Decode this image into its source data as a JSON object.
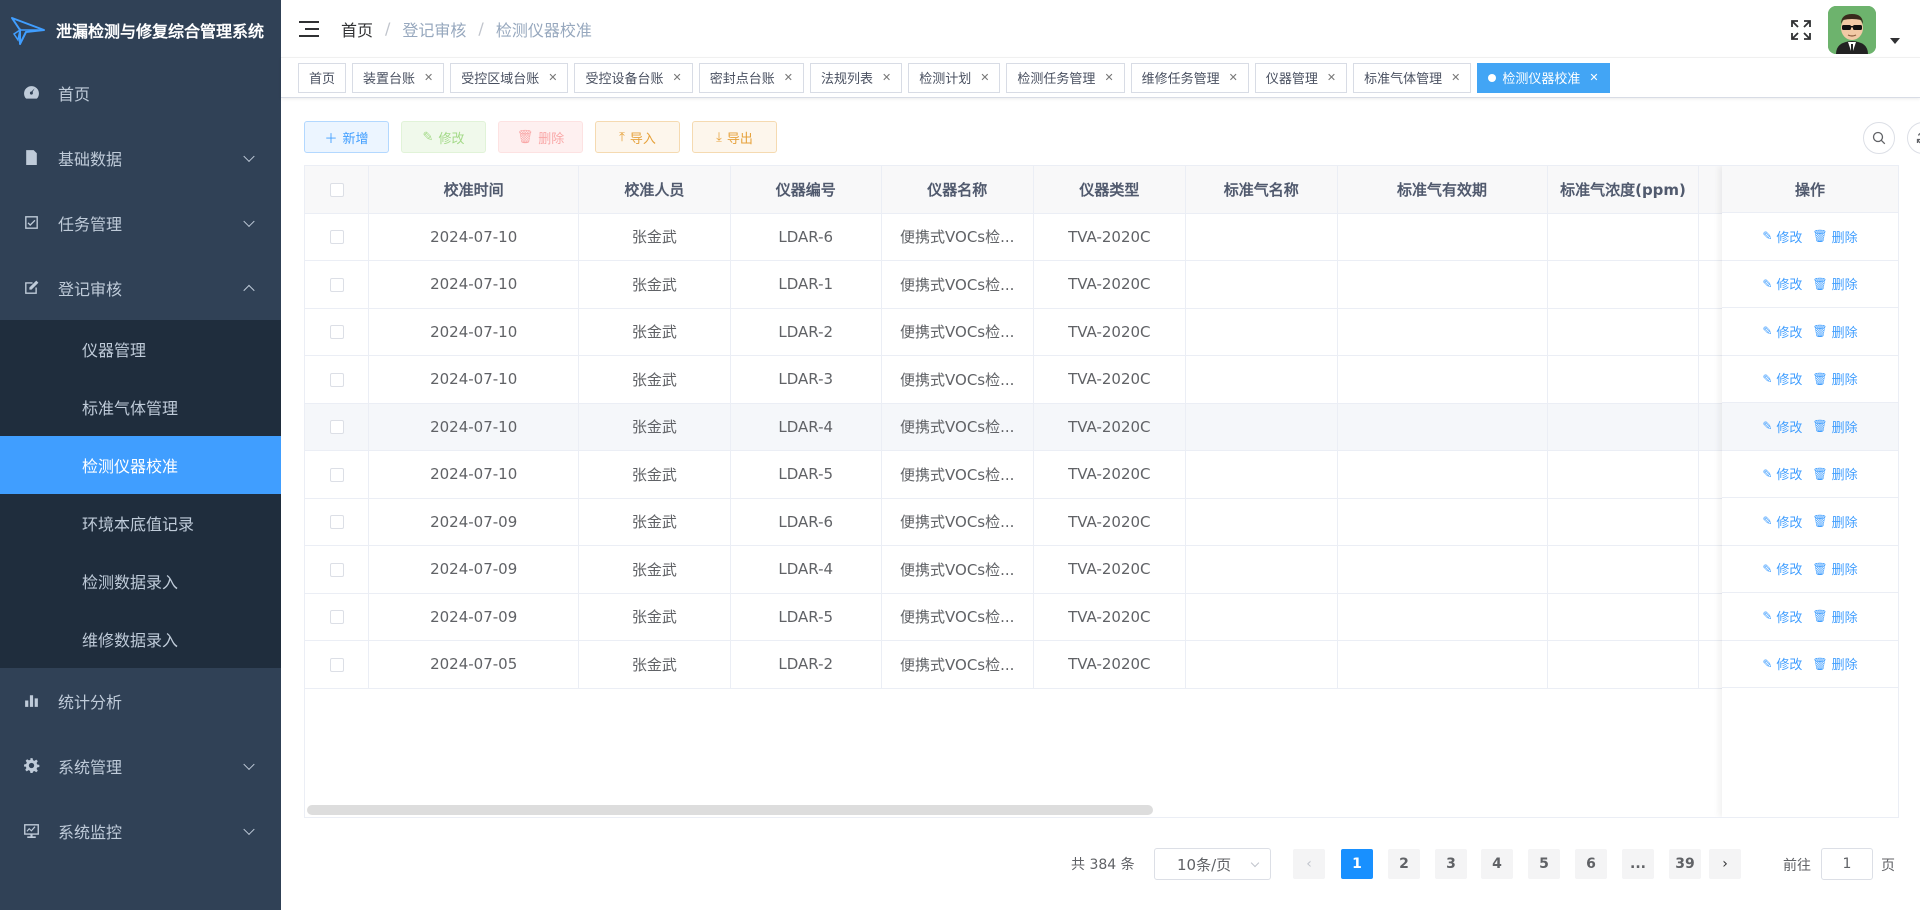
{
  "app": {
    "title": "泄漏检测与修复综合管理系统"
  },
  "sidebar": {
    "items": [
      {
        "label": "首页",
        "icon": "dashboard-icon"
      },
      {
        "label": "基础数据",
        "icon": "document-icon",
        "expandable": true
      },
      {
        "label": "任务管理",
        "icon": "checkbox-icon",
        "expandable": true
      },
      {
        "label": "登记审核",
        "icon": "edit-icon",
        "expandable": true,
        "expanded": true
      },
      {
        "label": "统计分析",
        "icon": "bar-chart-icon"
      },
      {
        "label": "系统管理",
        "icon": "gear-icon",
        "expandable": true
      },
      {
        "label": "系统监控",
        "icon": "monitor-icon",
        "expandable": true
      }
    ],
    "submenu": [
      "仪器管理",
      "标准气体管理",
      "检测仪器校准",
      "环境本底值记录",
      "检测数据录入",
      "维修数据录入"
    ],
    "active_sub": "检测仪器校准"
  },
  "breadcrumb": [
    "首页",
    "登记审核",
    "检测仪器校准"
  ],
  "tags": [
    {
      "label": "首页",
      "closable": false
    },
    {
      "label": "装置台账",
      "closable": true
    },
    {
      "label": "受控区域台账",
      "closable": true
    },
    {
      "label": "受控设备台账",
      "closable": true
    },
    {
      "label": "密封点台账",
      "closable": true
    },
    {
      "label": "法规列表",
      "closable": true
    },
    {
      "label": "检测计划",
      "closable": true
    },
    {
      "label": "检测任务管理",
      "closable": true
    },
    {
      "label": "维修任务管理",
      "closable": true
    },
    {
      "label": "仪器管理",
      "closable": true
    },
    {
      "label": "标准气体管理",
      "closable": true
    },
    {
      "label": "检测仪器校准",
      "closable": true,
      "active": true
    }
  ],
  "toolbar": {
    "add": "新增",
    "edit": "修改",
    "delete": "删除",
    "import": "导入",
    "export": "导出"
  },
  "table": {
    "columns": [
      "校准时间",
      "校准人员",
      "仪器编号",
      "仪器名称",
      "仪器类型",
      "标准气名称",
      "标准气有效期",
      "标准气浓度(ppm)",
      "操作"
    ],
    "rows": [
      {
        "time": "2024-07-10",
        "person": "张金武",
        "code": "LDAR-6",
        "name": "便携式VOCs检...",
        "type": "TVA-2020C"
      },
      {
        "time": "2024-07-10",
        "person": "张金武",
        "code": "LDAR-1",
        "name": "便携式VOCs检...",
        "type": "TVA-2020C"
      },
      {
        "time": "2024-07-10",
        "person": "张金武",
        "code": "LDAR-2",
        "name": "便携式VOCs检...",
        "type": "TVA-2020C"
      },
      {
        "time": "2024-07-10",
        "person": "张金武",
        "code": "LDAR-3",
        "name": "便携式VOCs检...",
        "type": "TVA-2020C"
      },
      {
        "time": "2024-07-10",
        "person": "张金武",
        "code": "LDAR-4",
        "name": "便携式VOCs检...",
        "type": "TVA-2020C"
      },
      {
        "time": "2024-07-10",
        "person": "张金武",
        "code": "LDAR-5",
        "name": "便携式VOCs检...",
        "type": "TVA-2020C"
      },
      {
        "time": "2024-07-09",
        "person": "张金武",
        "code": "LDAR-6",
        "name": "便携式VOCs检...",
        "type": "TVA-2020C"
      },
      {
        "time": "2024-07-09",
        "person": "张金武",
        "code": "LDAR-4",
        "name": "便携式VOCs检...",
        "type": "TVA-2020C"
      },
      {
        "time": "2024-07-09",
        "person": "张金武",
        "code": "LDAR-5",
        "name": "便携式VOCs检...",
        "type": "TVA-2020C"
      },
      {
        "time": "2024-07-05",
        "person": "张金武",
        "code": "LDAR-2",
        "name": "便携式VOCs检...",
        "type": "TVA-2020C"
      }
    ],
    "op_edit": "修改",
    "op_delete": "删除"
  },
  "pagination": {
    "total_text": "共 384 条",
    "page_size": "10条/页",
    "pages": [
      "1",
      "2",
      "3",
      "4",
      "5",
      "6",
      "...",
      "39"
    ],
    "current": "1",
    "goto_label": "前往",
    "goto_value": "1",
    "goto_suffix": "页"
  }
}
